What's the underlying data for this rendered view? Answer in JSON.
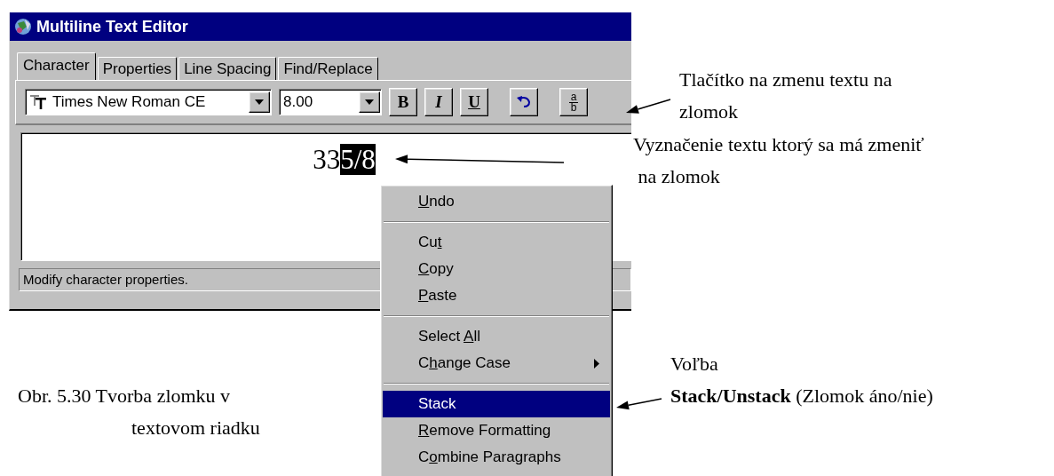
{
  "window": {
    "title": "Multiline Text Editor",
    "tabs": [
      {
        "label": "Character",
        "selected": true
      },
      {
        "label": "Properties",
        "selected": false
      },
      {
        "label": "Line Spacing",
        "selected": false
      },
      {
        "label": "Find/Replace",
        "selected": false
      }
    ],
    "toolbar": {
      "font": "Times New Roman CE",
      "size": "8.00",
      "buttons": [
        {
          "kind": "bold",
          "label": "B"
        },
        {
          "kind": "italic",
          "label": "I"
        },
        {
          "kind": "underline",
          "label": "U"
        },
        {
          "kind": "undo"
        },
        {
          "kind": "stack",
          "label_top": "a",
          "label_bottom": "b"
        }
      ]
    },
    "editor": {
      "text": "33",
      "selected_text": "5/8"
    },
    "status_bar": "Modify character properties."
  },
  "context_menu": {
    "items": [
      {
        "kind": "item",
        "key": "U",
        "post": "ndo",
        "selected": false
      },
      {
        "kind": "separator"
      },
      {
        "kind": "item",
        "pre": "Cu",
        "key": "t",
        "selected": false
      },
      {
        "kind": "item",
        "key": "C",
        "post": "opy",
        "selected": false
      },
      {
        "kind": "item",
        "key": "P",
        "post": "aste",
        "selected": false
      },
      {
        "kind": "separator"
      },
      {
        "kind": "item",
        "pre": "Select ",
        "key": "A",
        "post": "ll",
        "selected": false
      },
      {
        "kind": "submenu",
        "pre": "C",
        "key": "h",
        "post": "ange Case",
        "selected": false
      },
      {
        "kind": "separator"
      },
      {
        "kind": "item",
        "pre": "Stack",
        "selected": true
      },
      {
        "kind": "item",
        "key": "R",
        "post": "emove Formatting",
        "selected": false
      },
      {
        "kind": "item",
        "pre": "C",
        "key": "o",
        "post": "mbine Paragraphs",
        "selected": false
      }
    ]
  },
  "annotations": [
    {
      "kind": "button",
      "lines": [
        "Tlačítko na zmenu textu na",
        "zlomok"
      ]
    },
    {
      "kind": "selection",
      "lines": [
        "Vyznačenie textu ktorý sa má zmeniť",
        " na zlomok"
      ]
    },
    {
      "kind": "menu",
      "lines": [
        "Voľba",
        "**Stack/Unstack** (Zlomok áno/nie)"
      ]
    }
  ],
  "caption": [
    "Obr. 5.30 Tvorba zlomku v",
    "textovom riadku"
  ]
}
